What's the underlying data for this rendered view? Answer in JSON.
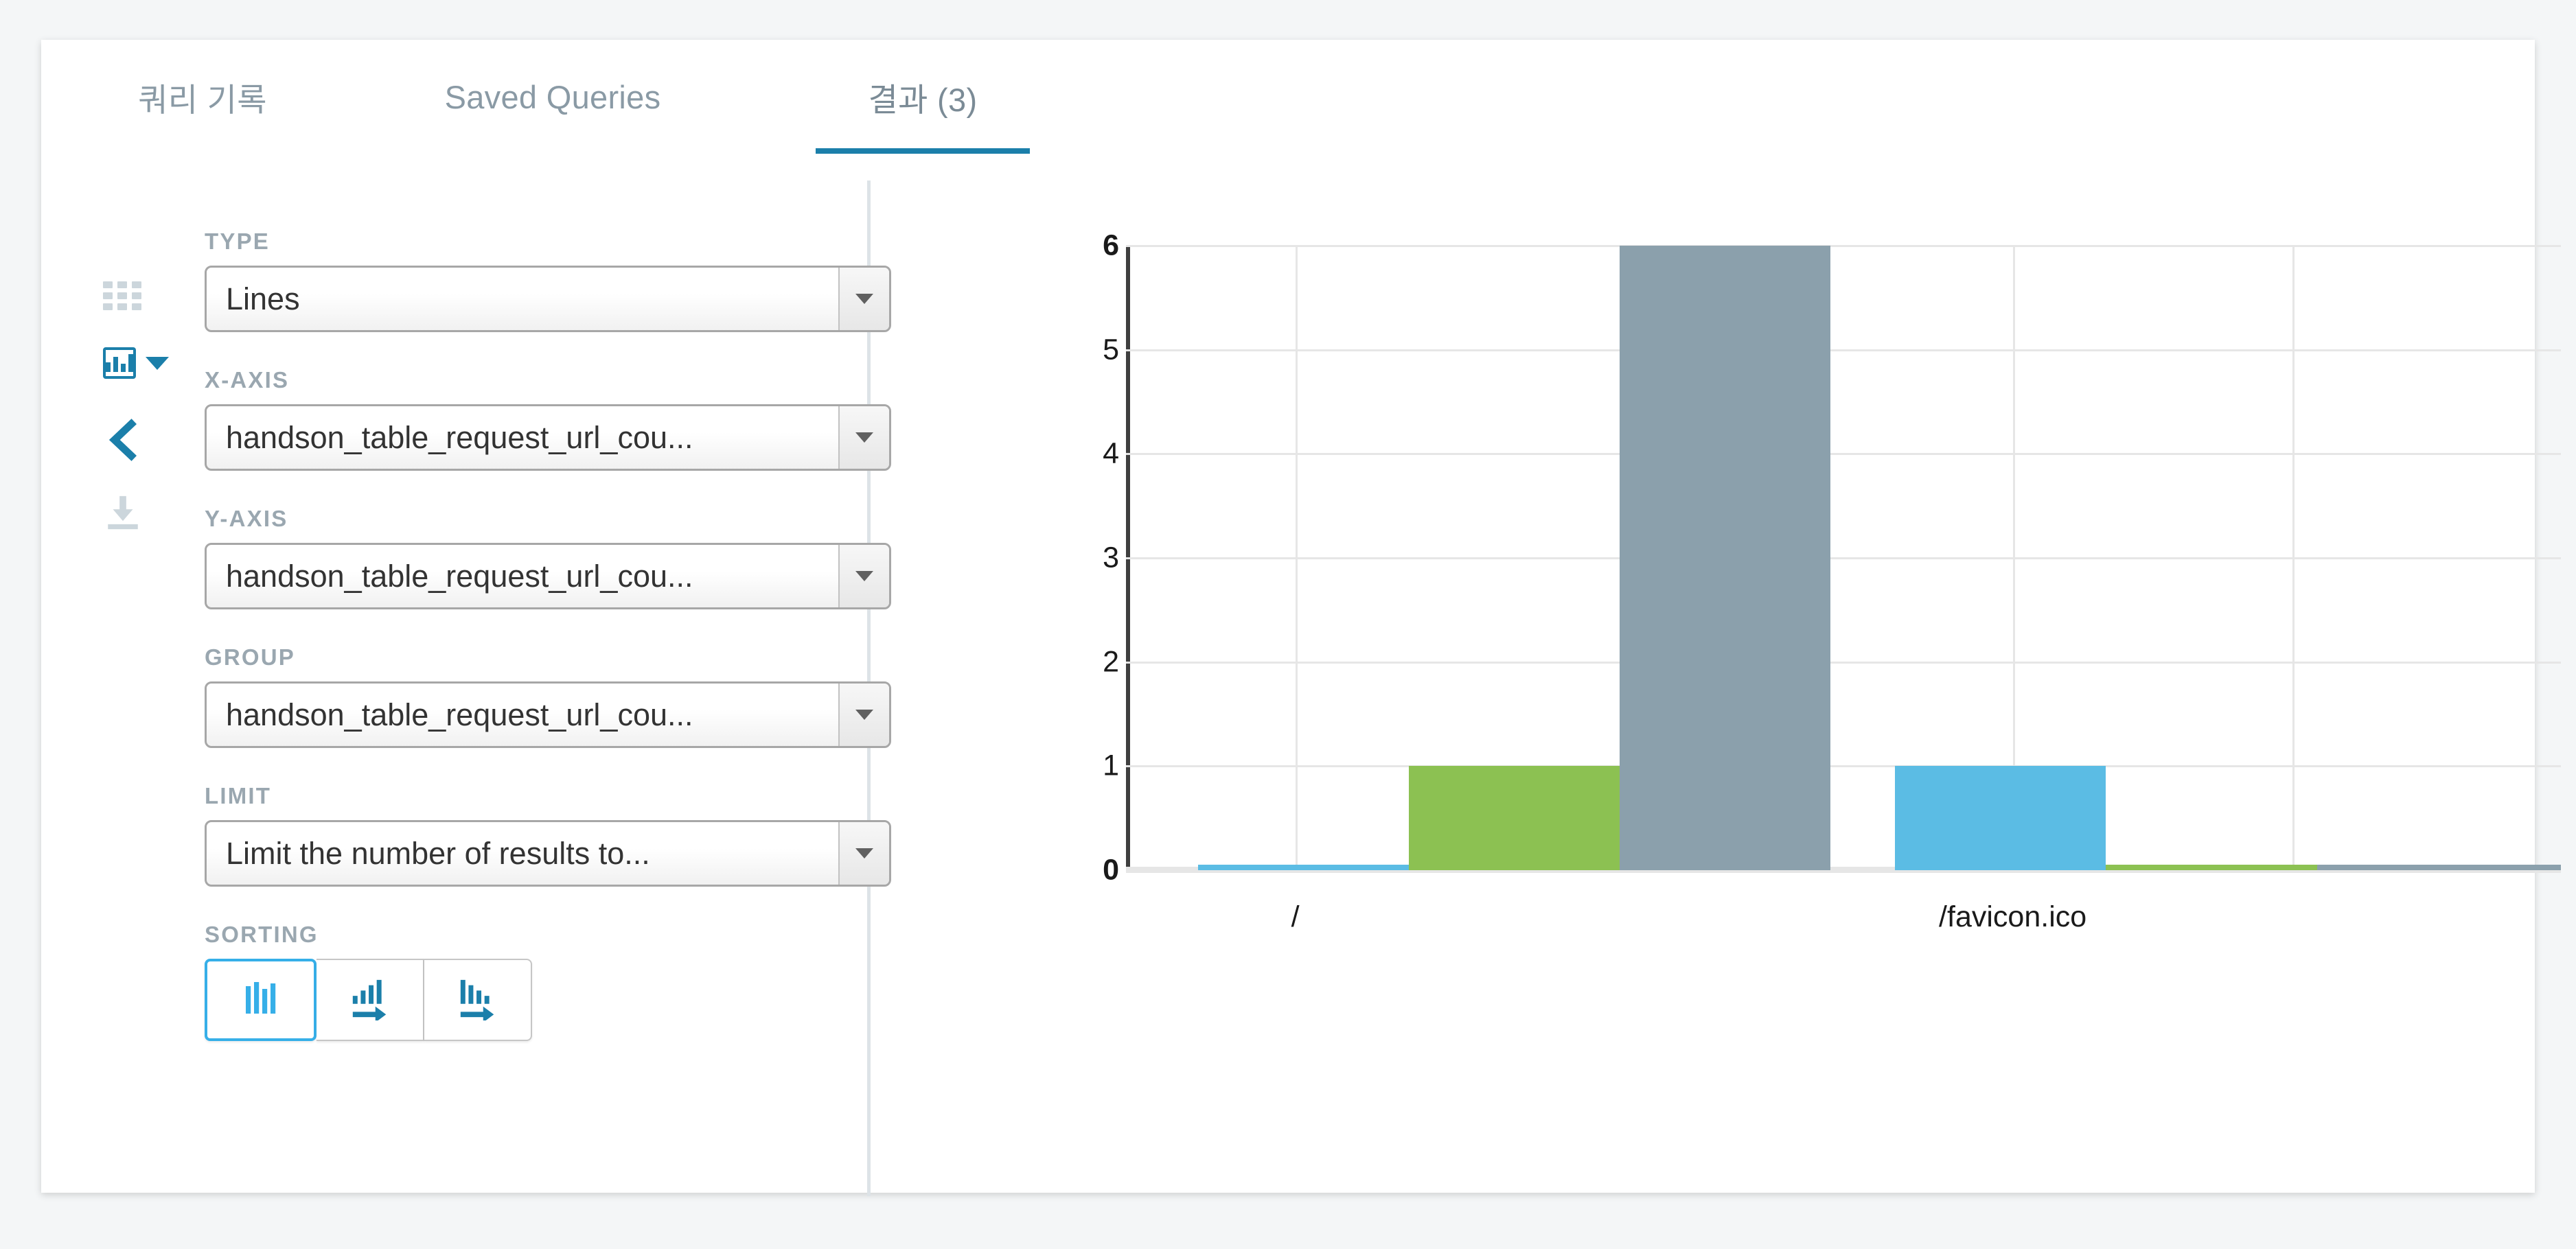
{
  "tabs": [
    {
      "label": "쿼리 기록",
      "active": false
    },
    {
      "label": "Saved Queries",
      "active": false
    },
    {
      "label": "결과 (3)",
      "active": true
    }
  ],
  "rail": {
    "table_icon": "grid-table-icon",
    "chart_icon": "bar-chart-icon",
    "chart_dropdown_icon": "chevron-down-icon",
    "collapse_icon": "chevron-left-icon",
    "download_icon": "download-icon"
  },
  "form": {
    "fields": [
      {
        "label": "TYPE",
        "value": "Lines"
      },
      {
        "label": "X-AXIS",
        "value": "handson_table_request_url_cou..."
      },
      {
        "label": "Y-AXIS",
        "value": "handson_table_request_url_cou..."
      },
      {
        "label": "GROUP",
        "value": "handson_table_request_url_cou..."
      },
      {
        "label": "LIMIT",
        "value": "Limit the number of results to..."
      }
    ],
    "sorting": {
      "label": "SORTING",
      "buttons": [
        {
          "name": "sort-none",
          "active": true
        },
        {
          "name": "sort-ascending",
          "active": false
        },
        {
          "name": "sort-descending",
          "active": false
        }
      ]
    }
  },
  "colors": {
    "accent": "#1b7faa",
    "active_border": "#36afe8",
    "series_blue": "#5BBCE4",
    "series_green": "#8CC152",
    "series_gray": "#8BA0AC",
    "grid": "#e6e6e6",
    "axis": "#3f3f3f",
    "label_muted": "#9aa7b0"
  },
  "chart_data": {
    "type": "bar",
    "title": "",
    "xlabel": "",
    "ylabel": "",
    "ylim": [
      0,
      6
    ],
    "yticks": [
      0,
      1,
      2,
      3,
      4,
      5,
      6
    ],
    "grid": true,
    "legend": "none",
    "categories": [
      "/",
      "/favicon.ico"
    ],
    "xtick_labels": [
      "/",
      "/favicon.ico"
    ],
    "xtick_positions_pct": [
      11.8,
      61.8
    ],
    "vertical_gridlines_pct": [
      11.8,
      35.7,
      61.8,
      81.3
    ],
    "series": [
      {
        "name": "series-blue",
        "color": "#5BBCE4",
        "values": [
          0,
          1
        ],
        "bars": [
          {
            "x_pct": 5.0,
            "width_pct": 14.7,
            "value": 0
          },
          {
            "x_pct": 53.6,
            "width_pct": 14.7,
            "value": 1
          }
        ]
      },
      {
        "name": "series-green",
        "color": "#8CC152",
        "values": [
          1,
          0
        ],
        "bars": [
          {
            "x_pct": 19.7,
            "width_pct": 14.7,
            "value": 1
          },
          {
            "x_pct": 68.3,
            "width_pct": 14.7,
            "value": 0
          }
        ]
      },
      {
        "name": "series-gray",
        "color": "#8BA0AC",
        "values": [
          6,
          0
        ],
        "bars": [
          {
            "x_pct": 34.4,
            "width_pct": 14.7,
            "value": 6
          },
          {
            "x_pct": 83.0,
            "width_pct": 17.0,
            "value": 0
          }
        ]
      }
    ]
  }
}
